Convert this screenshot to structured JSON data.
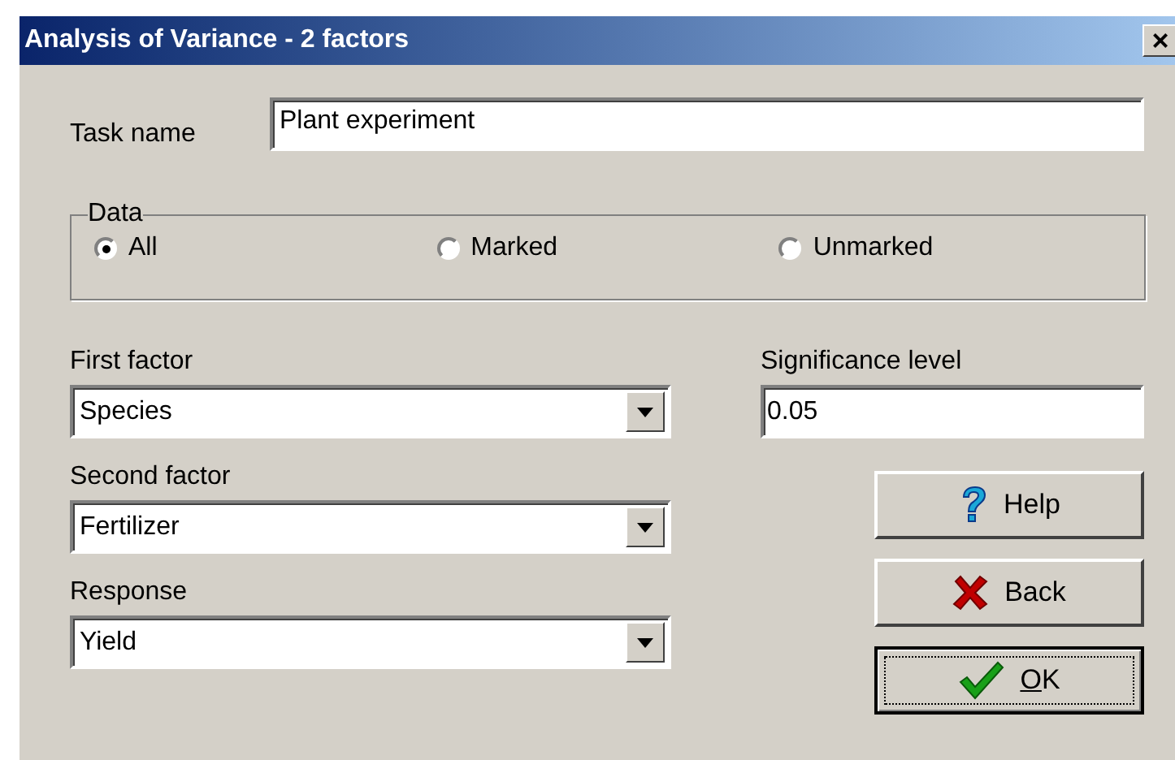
{
  "window": {
    "title": "Analysis of Variance - 2 factors",
    "close": "×"
  },
  "task_name": {
    "label": "Task name",
    "value": "Plant experiment"
  },
  "data_group": {
    "label": "Data",
    "options": [
      {
        "label": "All",
        "selected": true
      },
      {
        "label": "Marked",
        "selected": false
      },
      {
        "label": "Unmarked",
        "selected": false
      }
    ]
  },
  "first_factor": {
    "label": "First factor",
    "value": "Species"
  },
  "significance": {
    "label": "Significance level",
    "value": "0.05"
  },
  "second_factor": {
    "label": "Second factor",
    "value": "Fertilizer"
  },
  "response": {
    "label": "Response",
    "value": "Yield"
  },
  "buttons": [
    {
      "kind": "help",
      "label": "Help",
      "default": false,
      "mnemonic_first": false
    },
    {
      "kind": "back",
      "label": "Back",
      "default": false,
      "mnemonic_first": false
    },
    {
      "kind": "ok",
      "label": "OK",
      "default": true,
      "mnemonic_first": true
    }
  ]
}
